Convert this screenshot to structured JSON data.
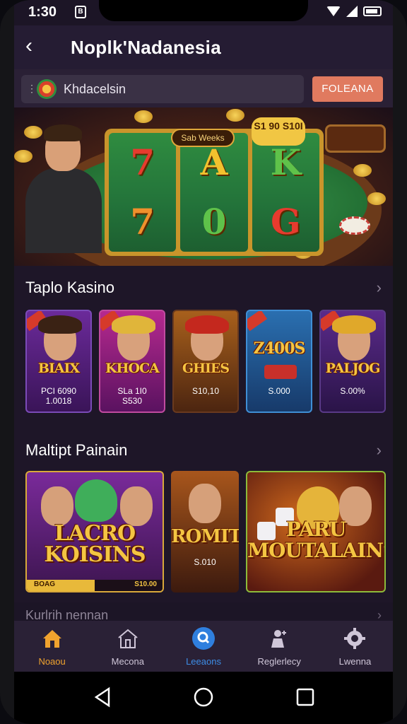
{
  "status_bar": {
    "time": "1:30",
    "left_badge": "B"
  },
  "header": {
    "title": "Noplk'Nadanesia"
  },
  "search": {
    "value": "Khdacelsin"
  },
  "action_button": {
    "label": "FOLEANA"
  },
  "banner": {
    "marquee": "Sab Weeks",
    "price_tag": "S1 90 S10I",
    "reels": [
      {
        "top": "7",
        "bottom": "7"
      },
      {
        "top": "A",
        "bottom": "0"
      },
      {
        "top": "K",
        "bottom": "G"
      }
    ]
  },
  "section_top": {
    "title": "Taplo Kasino",
    "cards": [
      {
        "name": "BIAIX",
        "sub1": "PCI 6090",
        "sub2": "1.0018"
      },
      {
        "name": "KHOCA",
        "sub1": "SLa 1I0",
        "sub2": "S530"
      },
      {
        "name": "GHIES",
        "sub1": "S10,10",
        "sub2": ""
      },
      {
        "name": "Z400S",
        "sub1": "S.000",
        "sub2": ""
      },
      {
        "name": "PALJOG",
        "sub1": "S.00%",
        "sub2": ""
      }
    ]
  },
  "section_multi": {
    "title": "Maltipt Painain",
    "cards": [
      {
        "title_line1": "LACRO",
        "title_line2": "KOISINS",
        "bar_left": "BOAG",
        "bar_right": "S10.00",
        "progress": 0.5
      },
      {
        "title": "ROMIT",
        "sub": "S.010"
      },
      {
        "title_line1": "PARU",
        "title_line2": "MOUTALAINS"
      }
    ]
  },
  "peek_section": {
    "title": "Kurlrih nennan"
  },
  "bottom_nav": {
    "items": [
      {
        "label": "Noaou"
      },
      {
        "label": "Mecona"
      },
      {
        "label": "Leeaons"
      },
      {
        "label": "Reglerlecy"
      },
      {
        "label": "Lwenna"
      }
    ]
  },
  "colors": {
    "accent_orange": "#f0a32e",
    "accent_blue": "#3d8de6",
    "button": "#e07a5f"
  }
}
